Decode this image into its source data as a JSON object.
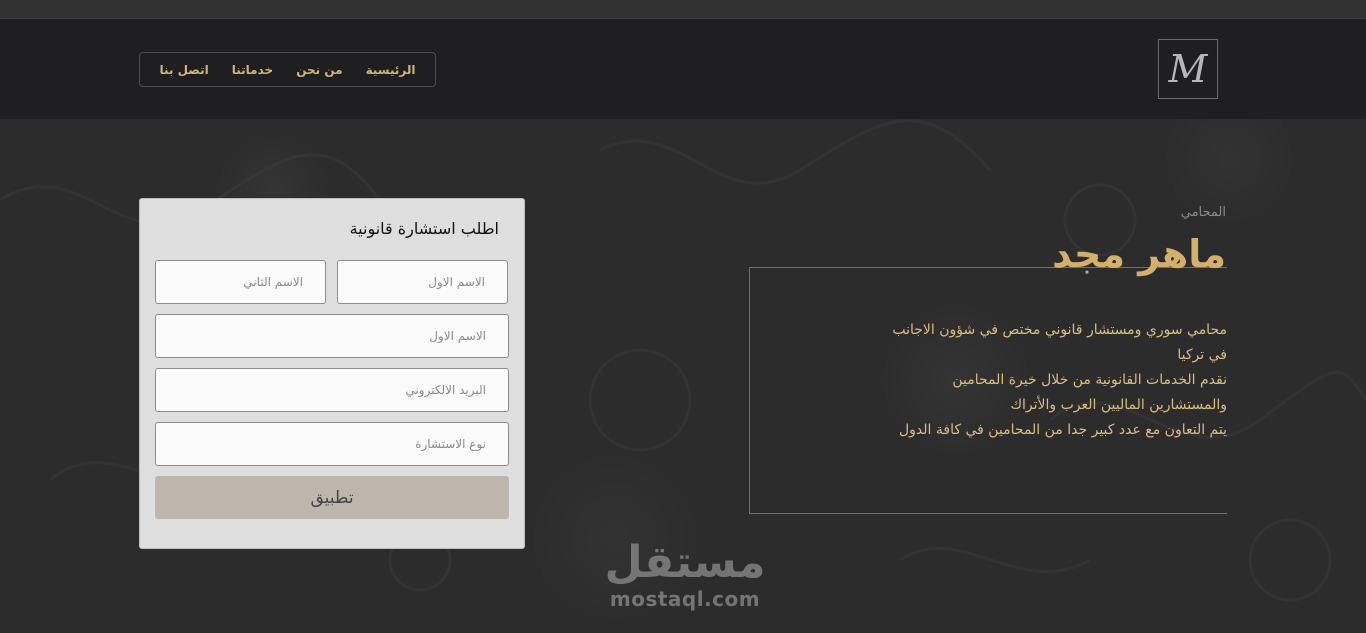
{
  "header": {
    "logo_text": "M",
    "nav": [
      {
        "label": "الرئيسية"
      },
      {
        "label": "من نحن"
      },
      {
        "label": "خدماتنا"
      },
      {
        "label": "اتصل بنا"
      }
    ]
  },
  "hero": {
    "role": "المحامي",
    "name": "ماهر مجد",
    "description": [
      "محامي سوري ومستشار قانوني مختص في شؤون الاجانب",
      "في تركيا",
      "نقدم الخدمات القانونية من خلال خيرة المحامين",
      "والمستشارين الماليين العرب والأتراك",
      "يتم التعاون مع عدد كبير جدا من المحامين في كافة الدول"
    ]
  },
  "form": {
    "title": "اطلب استشارة قانونية",
    "first_name_placeholder": "الاسم الاول",
    "last_name_placeholder": "الاسم الثاني",
    "name_placeholder": "الاسم الاول",
    "email_placeholder": "البريد الالكتروني",
    "type_placeholder": "نوع الاستشارة",
    "submit_label": "تطبيق"
  },
  "watermark": {
    "arabic": "مستقل",
    "latin": "mostaql.com"
  },
  "colors": {
    "accent": "#d4b06a",
    "header_bg": "#1f1f21",
    "form_bg": "#dedede",
    "button_bg": "#bdb6ac"
  }
}
